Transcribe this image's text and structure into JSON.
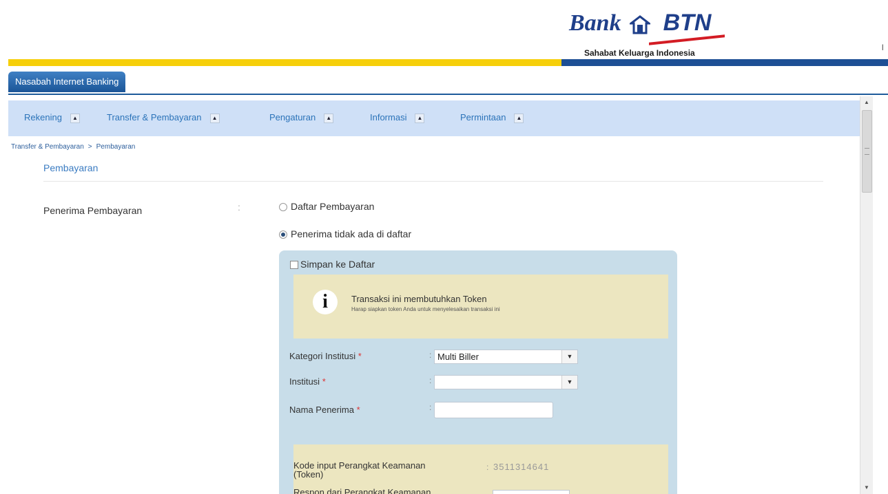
{
  "header": {
    "brand_bank": "Bank",
    "brand_btn": "BTN",
    "tagline": "Sahabat Keluarga Indonesia",
    "edge_mark": "I"
  },
  "tabs": [
    {
      "label": "Nasabah Internet Banking"
    }
  ],
  "menu": [
    {
      "label": "Rekening"
    },
    {
      "label": "Transfer & Pembayaran"
    },
    {
      "label": "Pengaturan"
    },
    {
      "label": "Informasi"
    },
    {
      "label": "Permintaan"
    }
  ],
  "breadcrumb": {
    "parent": "Transfer & Pembayaran",
    "separator": ">",
    "current": "Pembayaran"
  },
  "page": {
    "title": "Pembayaran"
  },
  "form": {
    "recipient_label": "Penerima Pembayaran",
    "colon": ":",
    "options": [
      {
        "label": "Daftar Pembayaran",
        "selected": false
      },
      {
        "label": "Penerima tidak ada di daftar",
        "selected": true
      }
    ],
    "save_to_list": {
      "label": "Simpan ke Daftar",
      "checked": false
    },
    "info": {
      "title": "Transaksi ini membutuhkan Token",
      "subtitle": "Harap siapkan token Anda untuk menyelesaikan transaksi ini",
      "icon": "i"
    },
    "required_mark": "*",
    "fields": {
      "kategori": {
        "label": "Kategori Institusi",
        "value": "Multi Biller"
      },
      "institusi": {
        "label": "Institusi",
        "value": ""
      },
      "nama": {
        "label": "Nama Penerima",
        "value": ""
      }
    },
    "dropdown_glyph": "▼",
    "token": {
      "label_line1": "Kode input Perangkat Keamanan",
      "label_line2": "(Token)",
      "value": "3511314641",
      "respon_label": "Respon dari Perangkat Keamanan"
    }
  },
  "scrollbar": {
    "up": "▲",
    "down": "▼"
  },
  "colors": {
    "accent_blue": "#1d4f95",
    "accent_yellow": "#f6cf0a",
    "menu_bg": "#cfe0f7",
    "panel_bg": "#c8dde9",
    "info_bg": "#ece6c0",
    "brand_red": "#d31c24"
  }
}
